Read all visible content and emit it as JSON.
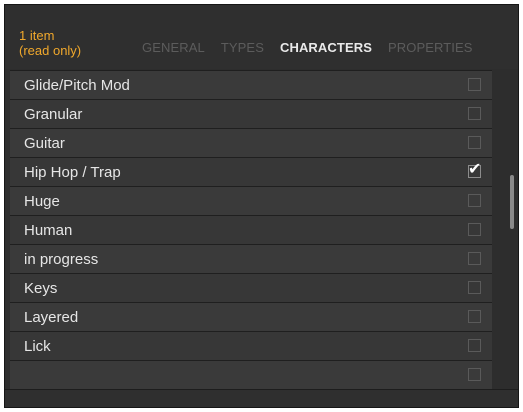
{
  "header": {
    "item_count": "1 item",
    "item_status": "(read only)",
    "tabs": [
      {
        "label": "GENERAL",
        "active": false
      },
      {
        "label": "TYPES",
        "active": false
      },
      {
        "label": "CHARACTERS",
        "active": true
      },
      {
        "label": "PROPERTIES",
        "active": false
      }
    ]
  },
  "list": {
    "items": [
      {
        "label": "Glide/Pitch Mod",
        "checked": false
      },
      {
        "label": "Granular",
        "checked": false
      },
      {
        "label": "Guitar",
        "checked": false
      },
      {
        "label": "Hip Hop / Trap",
        "checked": true
      },
      {
        "label": "Huge",
        "checked": false
      },
      {
        "label": "Human",
        "checked": false
      },
      {
        "label": "in progress",
        "checked": false
      },
      {
        "label": "Keys",
        "checked": false
      },
      {
        "label": "Layered",
        "checked": false
      },
      {
        "label": "Lick",
        "checked": false
      },
      {
        "label": "",
        "checked": false
      }
    ]
  },
  "check_glyph": "✔",
  "colors": {
    "panel_background": "#2d2d2d",
    "item_count": "#f0a82c",
    "active_tab": "#e9e9e9",
    "inactive_tab": "#5c5c5c",
    "row_text": "#e6e6e6",
    "scrollbar": "#8a8a8a"
  }
}
